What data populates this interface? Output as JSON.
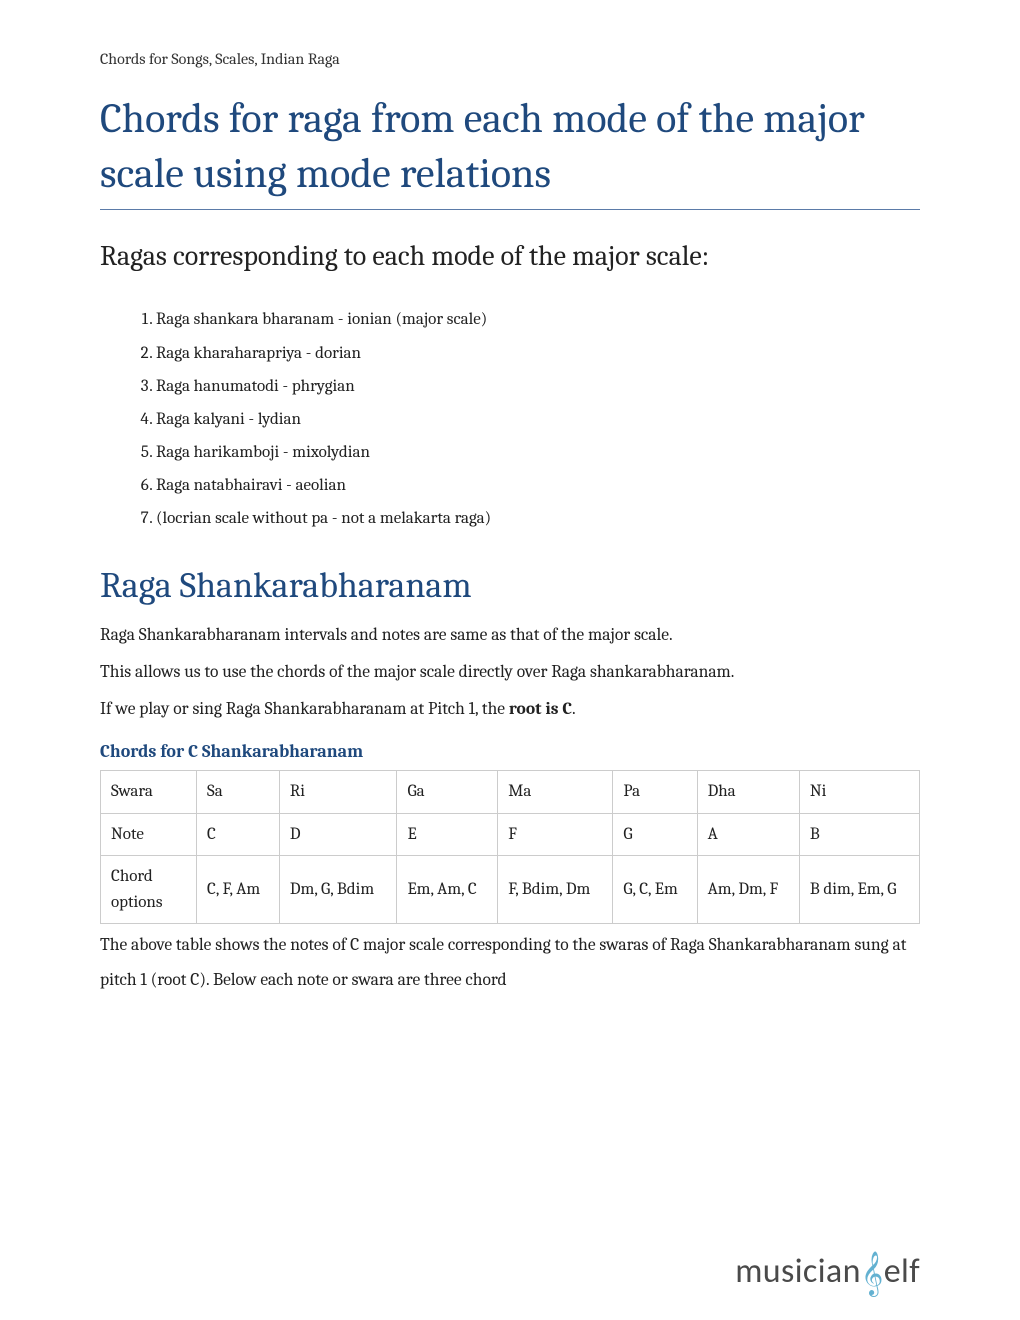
{
  "breadcrumb": "Chords for Songs, Scales, Indian Raga",
  "main_title": "Chords for raga from each mode of the major scale using mode relations",
  "sub_title": "Ragas corresponding to each mode of the major scale:",
  "raga_list": [
    "Raga shankara bharanam - ionian (major scale)",
    "Raga kharaharapriya - dorian",
    "Raga hanumatodi - phrygian",
    "Raga kalyani - lydian",
    "Raga harikamboji - mixolydian",
    "Raga natabhairavi - aeolian",
    "(locrian scale without pa - not a melakarta raga)"
  ],
  "section_title": "Raga Shankarabharanam",
  "p1": "Raga Shankarabharanam intervals and notes are same as that of the major scale.",
  "p2": "This allows us to use the chords of the major scale directly over Raga shankarabharanam.",
  "p3_pre": "If we play or sing Raga Shankarabharanam at Pitch 1, the ",
  "p3_bold": "root is C",
  "p3_post": ".",
  "chords_label": "Chords for C Shankarabharanam",
  "table": {
    "row1_label": "Swara",
    "row1": [
      "Sa",
      "Ri",
      "Ga",
      "Ma",
      "Pa",
      "Dha",
      "Ni"
    ],
    "row2_label": "Note",
    "row2": [
      "C",
      "D",
      "E",
      "F",
      "G",
      "A",
      "B"
    ],
    "row3_label": "Chord options",
    "row3": [
      "C, F, Am",
      "Dm, G, Bdim",
      "Em, Am, C",
      "F, Bdim, Dm",
      "G, C, Em",
      "Am, Dm, F",
      "B dim, Em, G"
    ]
  },
  "p4": "The above table shows the notes of C major scale corresponding to the swaras of Raga Shankarabharanam sung at pitch 1 (root C). Below each note or swara are three chord",
  "brand_left": "musician",
  "brand_right": "elf"
}
